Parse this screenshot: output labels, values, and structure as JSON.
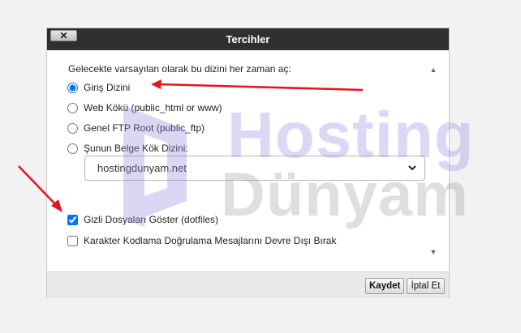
{
  "dialog": {
    "title": "Tercihler",
    "close_label": "✕"
  },
  "prefs": {
    "intro": "Gelecekte varsayılan olarak bu dizini her zaman aç:",
    "options": [
      {
        "label": "Giriş Dizini",
        "checked": true
      },
      {
        "label": "Web Kökü (public_html or www)",
        "checked": false
      },
      {
        "label": "Genel FTP Root (public_ftp)",
        "checked": false
      },
      {
        "label": "Şunun Belge Kök Dizini:",
        "checked": false
      }
    ],
    "domain_select": {
      "value": "hostingdunyam.net"
    },
    "checkboxes": [
      {
        "label": "Gizli Dosyaları Göster (dotfiles)",
        "checked": true
      },
      {
        "label": "Karakter Kodlama Doğrulama Mesajlarını Devre Dışı Bırak",
        "checked": false
      }
    ]
  },
  "buttons": {
    "save": "Kaydet",
    "cancel": "İptal Et"
  },
  "watermark": {
    "line1": "Hosting",
    "line2": "Dünyam"
  },
  "icons": {
    "close": "close-icon",
    "chevron": "chevron-down-icon",
    "scroll_up": "scroll-up-icon",
    "scroll_down": "scroll-down-icon",
    "annotation": "red-arrow-icon"
  },
  "colors": {
    "titlebar": "#2f2f2f",
    "annotation_arrow": "#e8141c",
    "radio_accent": "#0075ff"
  }
}
